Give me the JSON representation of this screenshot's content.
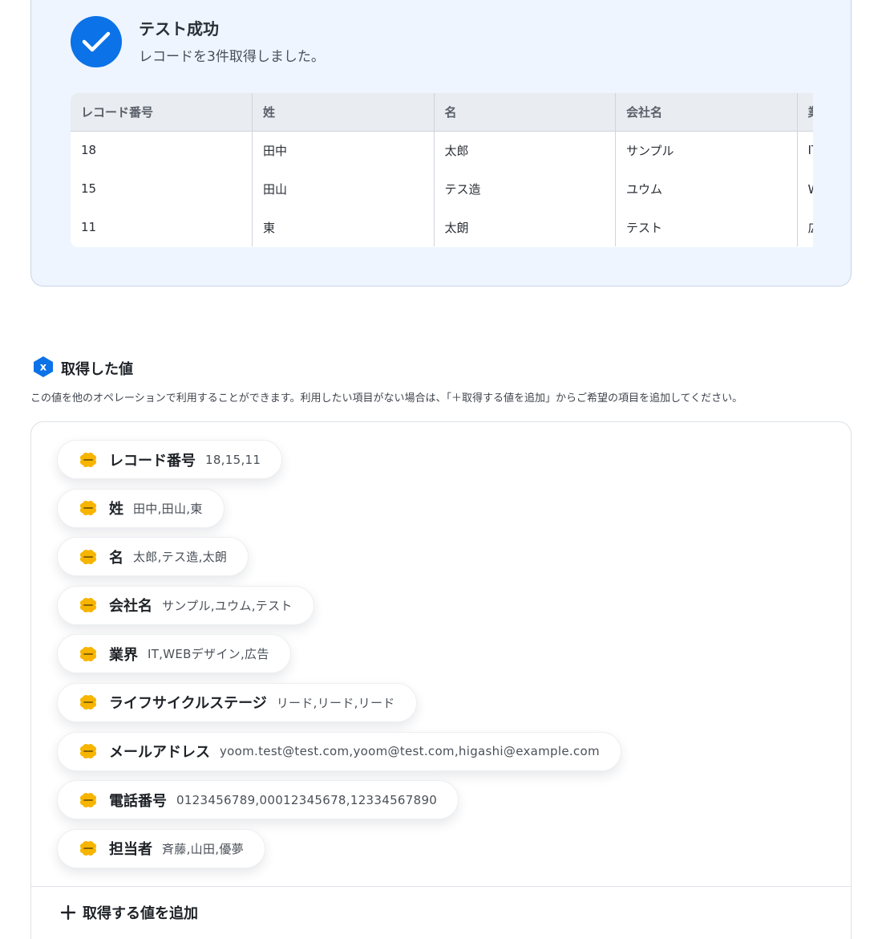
{
  "test_result": {
    "title": "テスト成功",
    "message": "レコードを3件取得しました。",
    "table": {
      "columns": [
        "レコード番号",
        "姓",
        "名",
        "会社名",
        "業界"
      ],
      "rows": [
        [
          "18",
          "田中",
          "太郎",
          "サンプル",
          "IT"
        ],
        [
          "15",
          "田山",
          "テス造",
          "ユウム",
          "WEBデザイン"
        ],
        [
          "11",
          "東",
          "太朗",
          "テスト",
          "広告"
        ]
      ]
    }
  },
  "acquired": {
    "title": "取得した値",
    "description": "この値を他のオペレーションで利用することができます。利用したい項目がない場合は、「＋取得する値を追加」からご希望の項目を追加してください。",
    "items": [
      {
        "name": "レコード番号",
        "value": "18,15,11",
        "icon": "kintone-logo"
      },
      {
        "name": "姓",
        "value": "田中,田山,東",
        "icon": "kintone-logo"
      },
      {
        "name": "名",
        "value": "太郎,テス造,太朗",
        "icon": "kintone-logo"
      },
      {
        "name": "会社名",
        "value": "サンプル,ユウム,テスト",
        "icon": "kintone-logo"
      },
      {
        "name": "業界",
        "value": "IT,WEBデザイン,広告",
        "icon": "kintone-logo"
      },
      {
        "name": "ライフサイクルステージ",
        "value": "リード,リード,リード",
        "icon": "kintone-logo"
      },
      {
        "name": "メールアドレス",
        "value": "yoom.test@test.com,yoom@test.com,higashi@example.com",
        "icon": "kintone-logo"
      },
      {
        "name": "電話番号",
        "value": "0123456789,00012345678,12334567890",
        "icon": "kintone-logo"
      },
      {
        "name": "担当者",
        "value": "斉藤,山田,優夢",
        "icon": "kintone-logo"
      }
    ],
    "add_label": "取得する値を追加"
  },
  "colors": {
    "accent": "#0b72e7",
    "panel_bg": "#eef5ff",
    "logo_yellow": "#f7b500"
  }
}
